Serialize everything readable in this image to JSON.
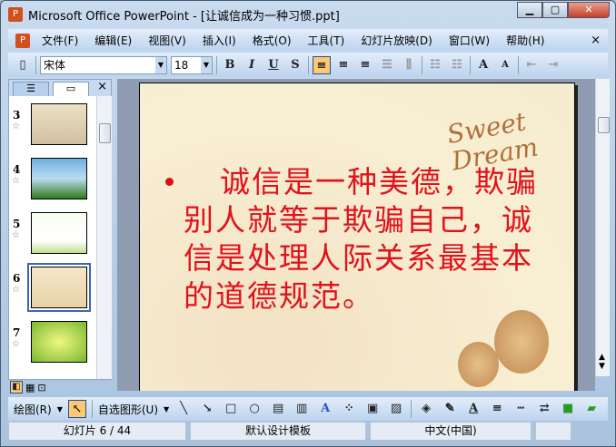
{
  "window": {
    "title": "Microsoft Office PowerPoint - [让诚信成为一种习惯.ppt]",
    "app_icon": "P",
    "min": "▁",
    "max": "▢",
    "close": "✕"
  },
  "menu": [
    "文件(F)",
    "编辑(E)",
    "视图(V)",
    "插入(I)",
    "格式(O)",
    "工具(T)",
    "幻灯片放映(D)",
    "窗口(W)",
    "帮助(H)"
  ],
  "menu_close": "×",
  "toolbar": {
    "font": "宋体",
    "size": "18",
    "bold": "B",
    "italic": "I",
    "underline": "U",
    "shadow": "S",
    "align_left": "≡",
    "align_center": "≡",
    "align_right": "≡",
    "grow": "A",
    "shrink": "A"
  },
  "panel": {
    "tab_outline": "☰",
    "tab_slides": "▭",
    "close": "×",
    "slides": [
      {
        "num": "3"
      },
      {
        "num": "4"
      },
      {
        "num": "5"
      },
      {
        "num": "6"
      },
      {
        "num": "7"
      }
    ]
  },
  "slide": {
    "text": "诚信是一种美德，欺骗别人就等于欺骗自己，诚信是处理人际关系最基本的道德规范。",
    "logo": "Sweet Dream"
  },
  "drawing": {
    "draw": "绘图(R)",
    "autoshapes": "自选图形(U)"
  },
  "status": {
    "slide": "幻灯片 6 / 44",
    "design": "默认设计模板",
    "lang": "中文(中国)"
  }
}
